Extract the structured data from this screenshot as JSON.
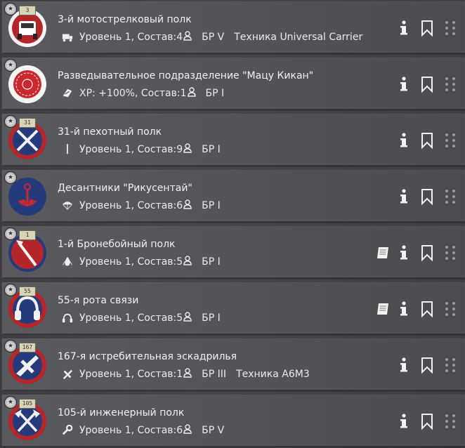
{
  "units": [
    {
      "rank": "3",
      "title": "3-й мотострелковый полк",
      "sub_icon": "truck-icon",
      "level": "Уровень 1, Состав:4",
      "br": "БР V",
      "vehicle": "Техника Universal Carrier",
      "has_book": false,
      "emblem": "truck-emblem"
    },
    {
      "rank": "",
      "title": "Разведывательное подразделение \"Мацу Кикан\"",
      "sub_icon": "xp-icon",
      "level": "XP: +100%, Состав:1",
      "br": "БР I",
      "vehicle": "",
      "has_book": false,
      "emblem": "chrysanthemum-emblem"
    },
    {
      "rank": "31",
      "title": "31-й пехотный полк",
      "sub_icon": "rifle-icon",
      "level": "Уровень 1, Состав:9",
      "br": "БР I",
      "vehicle": "",
      "has_book": false,
      "emblem": "crossed-rifles-emblem"
    },
    {
      "rank": "",
      "title": "Десантники \"Рикусентай\"",
      "sub_icon": "parachute-icon",
      "level": "Уровень 1, Состав:6",
      "br": "БР I",
      "vehicle": "",
      "has_book": false,
      "emblem": "anchor-emblem"
    },
    {
      "rank": "1",
      "title": "1-й Бронебойный полк",
      "sub_icon": "fire-icon",
      "level": "Уровень 1, Состав:5",
      "br": "БР I",
      "vehicle": "",
      "has_book": true,
      "emblem": "antitank-emblem"
    },
    {
      "rank": "55",
      "title": "55-я рота связи",
      "sub_icon": "headphones-icon",
      "level": "Уровень 1, Состав:5",
      "br": "БР I",
      "vehicle": "",
      "has_book": true,
      "emblem": "headphones-emblem"
    },
    {
      "rank": "167",
      "title": "167-я истребительная эскадрилья",
      "sub_icon": "plane-icon",
      "level": "Уровень 1, Состав:1",
      "br": "БР III",
      "vehicle": "Техника A6M3",
      "has_book": false,
      "emblem": "plane-emblem"
    },
    {
      "rank": "105",
      "title": "105-й инженерный полк",
      "sub_icon": "wrench-icon",
      "level": "Уровень 1, Состав:6",
      "br": "БР V",
      "vehicle": "",
      "has_book": false,
      "emblem": "axes-emblem"
    }
  ],
  "colors": {
    "emblem_red": "#b5262a",
    "emblem_navy": "#243a7a",
    "icon_white": "#f2f2f2"
  }
}
